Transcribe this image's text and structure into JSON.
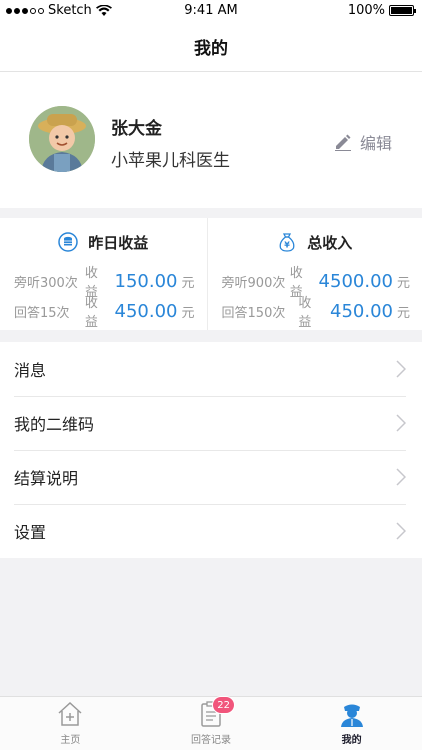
{
  "status_bar": {
    "carrier": "Sketch",
    "time": "9:41 AM",
    "battery": "100%",
    "signal_bars_filled": 3
  },
  "nav": {
    "title": "我的"
  },
  "profile": {
    "name": "张大金",
    "title": "小苹果儿科医生",
    "edit_label": "编辑"
  },
  "income": {
    "yesterday": {
      "heading": "昨日收益",
      "rows": [
        {
          "label": "旁听300次",
          "word": "收益",
          "amount": "150.00",
          "unit": "元"
        },
        {
          "label": "回答15次",
          "word": "收益",
          "amount": "450.00",
          "unit": "元"
        }
      ]
    },
    "total": {
      "heading": "总收入",
      "rows": [
        {
          "label": "旁听900次",
          "word": "收益",
          "amount": "4500.00",
          "unit": "元"
        },
        {
          "label": "回答150次",
          "word": "收益",
          "amount": "450.00",
          "unit": "元"
        }
      ]
    }
  },
  "menu": {
    "items": [
      {
        "label": "消息"
      },
      {
        "label": "我的二维码"
      },
      {
        "label": "结算说明"
      },
      {
        "label": "设置"
      }
    ]
  },
  "tabs": [
    {
      "label": "主页",
      "icon": "home-icon"
    },
    {
      "label": "回答记录",
      "icon": "clipboard-icon",
      "badge": "22"
    },
    {
      "label": "我的",
      "icon": "doctor-icon"
    }
  ],
  "colors": {
    "accent": "#2a86d8",
    "badge": "#f1557b",
    "active_tab": "#1d1d2c"
  }
}
